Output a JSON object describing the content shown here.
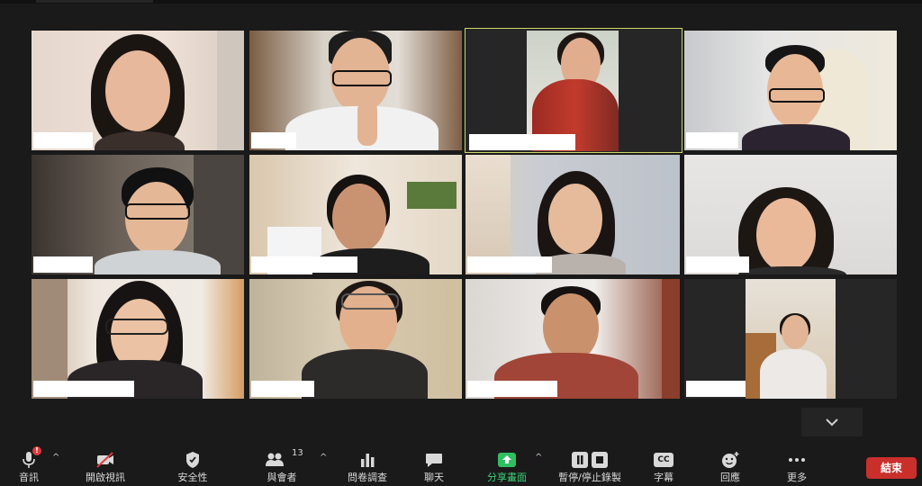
{
  "meeting": {
    "participants_count": "13",
    "tiles": [
      {
        "id": "p1",
        "name": ""
      },
      {
        "id": "p2",
        "name": ""
      },
      {
        "id": "p3",
        "name": "",
        "active": true
      },
      {
        "id": "p4",
        "name": ""
      },
      {
        "id": "p5",
        "name": ""
      },
      {
        "id": "p6",
        "name": ""
      },
      {
        "id": "p7",
        "name": ""
      },
      {
        "id": "p8",
        "name": ""
      },
      {
        "id": "p9",
        "name": ""
      },
      {
        "id": "p10",
        "name": ""
      },
      {
        "id": "p11",
        "name": ""
      },
      {
        "id": "p12",
        "name": ""
      }
    ]
  },
  "toolbar": {
    "audio_label": "音訊",
    "audio_badge": "!",
    "video_label": "開啟視訊",
    "security_label": "安全性",
    "participants_label": "與會者",
    "polls_label": "問卷調查",
    "chat_label": "聊天",
    "share_label": "分享畫面",
    "record_label": "暫停/停止錄製",
    "captions_label": "字幕",
    "captions_icon_text": "CC",
    "reactions_label": "回應",
    "more_label": "更多",
    "end_label": "結束"
  },
  "colors": {
    "active_speaker_border": "#cfd86a",
    "share_green": "#2fbf61",
    "end_red": "#c9302c"
  }
}
